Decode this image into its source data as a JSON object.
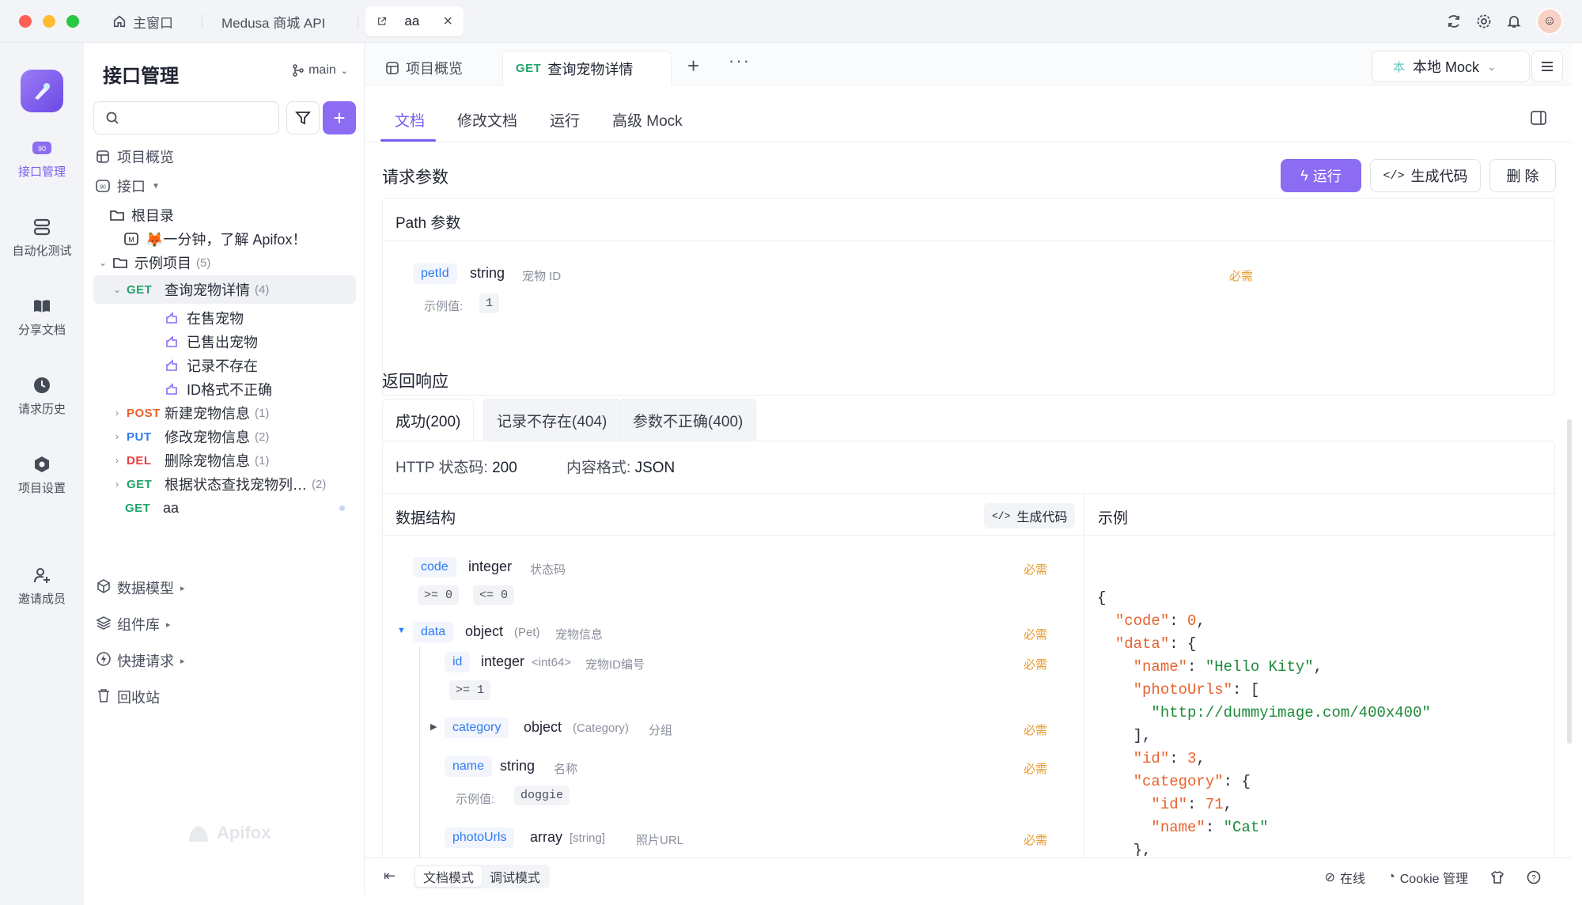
{
  "window": {
    "tabs": [
      {
        "label": "主窗口"
      },
      {
        "label": "Medusa 商城 API"
      },
      {
        "label": "aa"
      }
    ]
  },
  "rail": {
    "items": [
      {
        "label": "接口管理",
        "icon": "api-icon",
        "active": true
      },
      {
        "label": "自动化测试",
        "icon": "test-icon"
      },
      {
        "label": "分享文档",
        "icon": "book-icon"
      },
      {
        "label": "请求历史",
        "icon": "clock-icon"
      },
      {
        "label": "项目设置",
        "icon": "settings-icon"
      },
      {
        "label": "邀请成员",
        "icon": "user-plus-icon"
      }
    ]
  },
  "sidebar": {
    "title": "接口管理",
    "branch": "main",
    "search_placeholder": "",
    "overview": "项目概览",
    "interfaces": "接口",
    "root": "根目录",
    "intro_doc": "🦊一分钟，了解 Apifox！",
    "example_folder": "示例项目",
    "example_count": "(5)",
    "selected_method": "GET",
    "selected_name": "查询宠物详情",
    "selected_count": "(4)",
    "cases": [
      "在售宠物",
      "已售出宠物",
      "记录不存在",
      "ID格式不正确"
    ],
    "endpoints": [
      {
        "method": "POST",
        "name": "新建宠物信息",
        "count": "(1)"
      },
      {
        "method": "PUT",
        "name": "修改宠物信息",
        "count": "(2)"
      },
      {
        "method": "DEL",
        "name": "删除宠物信息",
        "count": "(1)"
      },
      {
        "method": "GET",
        "name": "根据状态查找宠物列…",
        "count": "(2)"
      }
    ],
    "aa_method": "GET",
    "aa_name": "aa",
    "links": [
      "数据模型",
      "组件库",
      "快捷请求",
      "回收站"
    ],
    "watermark": "Apifox"
  },
  "main": {
    "tabs": [
      {
        "label": "项目概览"
      },
      {
        "method": "GET",
        "label": "查询宠物详情"
      }
    ],
    "env": {
      "badge": "本",
      "label": "本地 Mock"
    },
    "subtabs": [
      "文档",
      "修改文档",
      "运行",
      "高级 Mock"
    ],
    "request_title": "请求参数",
    "buttons": {
      "run": "运行",
      "gen_code": "生成代码",
      "delete": "删 除"
    },
    "path_title": "Path 参数",
    "param": {
      "name": "petId",
      "type": "string",
      "desc": "宠物 ID",
      "required": "必需",
      "example_label": "示例值:",
      "example": "1"
    },
    "response_title": "返回响应",
    "response_tabs": [
      "成功(200)",
      "记录不存在(404)",
      "参数不正确(400)"
    ],
    "http_status_label": "HTTP 状态码: ",
    "http_status": "200",
    "content_type_label": "内容格式: ",
    "content_type": "JSON",
    "schema_title": "数据结构",
    "schema_gen": "生成代码",
    "example_title": "示例",
    "fields": {
      "code": {
        "name": "code",
        "type": "integer",
        "desc": "状态码",
        "required": "必需",
        "c1": ">= 0",
        "c2": "<= 0"
      },
      "data": {
        "name": "data",
        "type": "object",
        "ref": "(Pet)",
        "desc": "宠物信息",
        "required": "必需"
      },
      "id": {
        "name": "id",
        "type": "integer",
        "ref": "<int64>",
        "desc": "宠物ID编号",
        "required": "必需",
        "c1": ">= 1"
      },
      "category": {
        "name": "category",
        "type": "object",
        "ref": "(Category)",
        "desc": "分组",
        "required": "必需"
      },
      "name": {
        "name": "name",
        "type": "string",
        "desc": "名称",
        "required": "必需",
        "example_label": "示例值:",
        "example": "doggie"
      },
      "photoUrls": {
        "name": "photoUrls",
        "type": "array",
        "ref": "[string]",
        "desc": "照片URL",
        "required": "必需"
      }
    }
  },
  "bottom": {
    "modes": [
      "文档模式",
      "调试模式"
    ],
    "online": "在线",
    "cookie": "Cookie 管理"
  },
  "colors": {
    "accent": "#8c6cf2",
    "get": "#22a36b",
    "post": "#e8622c",
    "put": "#2f7bf5",
    "del": "#e83e3e"
  }
}
